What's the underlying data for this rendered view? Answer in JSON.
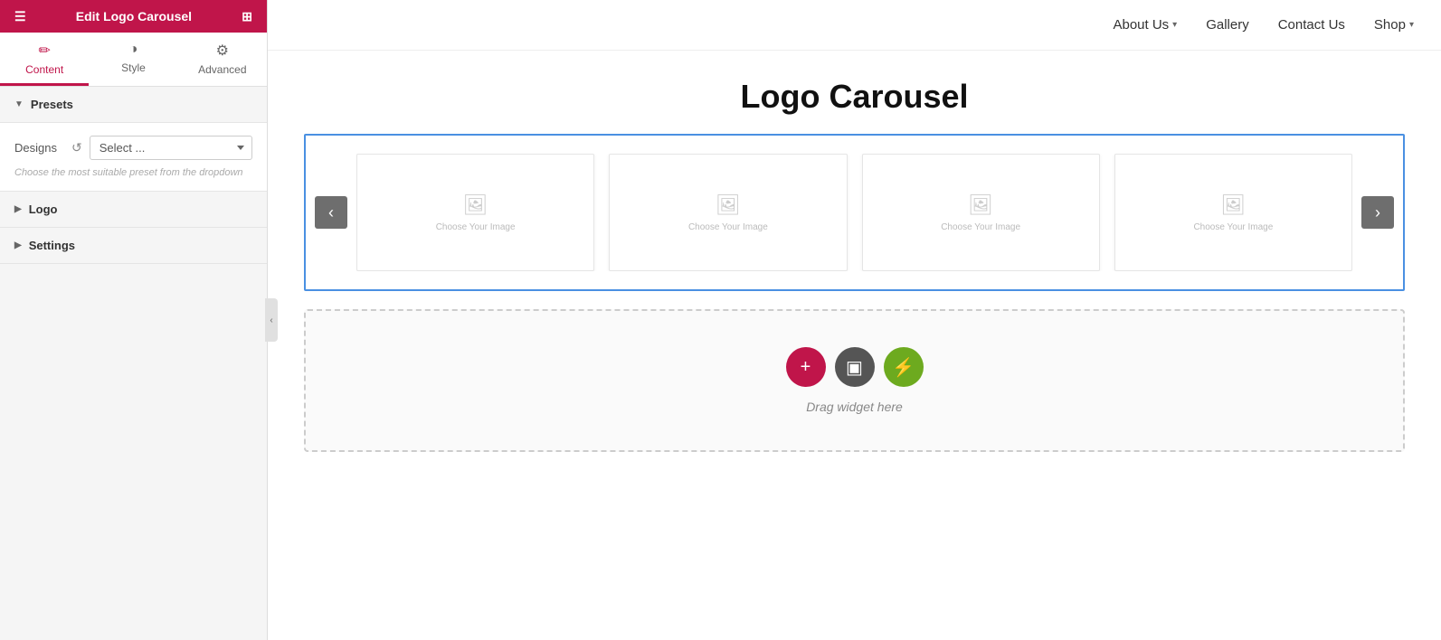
{
  "sidebar": {
    "header": {
      "title": "Edit Logo Carousel",
      "hamburger_icon": "☰",
      "grid_icon": "⊞"
    },
    "tabs": [
      {
        "id": "content",
        "label": "Content",
        "icon": "✏️",
        "active": true
      },
      {
        "id": "style",
        "label": "Style",
        "icon": "◑",
        "active": false
      },
      {
        "id": "advanced",
        "label": "Advanced",
        "icon": "⚙",
        "active": false
      }
    ],
    "sections": [
      {
        "id": "presets",
        "label": "Presets",
        "expanded": true,
        "content": {
          "designs_label": "Designs",
          "select_placeholder": "Select ...",
          "hint": "Choose the most suitable preset from the dropdown"
        }
      },
      {
        "id": "logo",
        "label": "Logo",
        "expanded": false
      },
      {
        "id": "settings",
        "label": "Settings",
        "expanded": false
      }
    ],
    "collapse_icon": "‹"
  },
  "nav": {
    "items": [
      {
        "label": "About Us",
        "has_dropdown": true
      },
      {
        "label": "Gallery",
        "has_dropdown": false
      },
      {
        "label": "Contact Us",
        "has_dropdown": false
      },
      {
        "label": "Shop",
        "has_dropdown": true
      }
    ]
  },
  "page": {
    "title": "Logo Carousel",
    "carousel": {
      "prev_arrow": "‹",
      "next_arrow": "›",
      "slides": [
        {
          "id": 1,
          "placeholder": "Choose Your Image"
        },
        {
          "id": 2,
          "placeholder": "Choose Your Image"
        },
        {
          "id": 3,
          "placeholder": "Choose Your Image"
        },
        {
          "id": 4,
          "placeholder": "Choose Your Image"
        }
      ],
      "image_icon": "🖼"
    },
    "drop_zone": {
      "label": "Drag widget here",
      "btn_plus": "+",
      "btn_folder": "▣",
      "btn_lightning": "⚡"
    }
  }
}
